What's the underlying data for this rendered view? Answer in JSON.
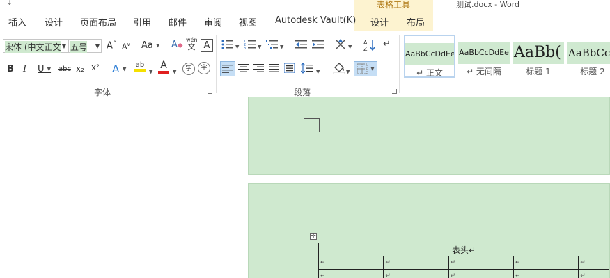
{
  "title_bar": {
    "quick_access_arrow": "⇣",
    "contextual_label": "表格工具",
    "document_title": "测试.docx - Word"
  },
  "tabs": [
    "插入",
    "设计",
    "页面布局",
    "引用",
    "邮件",
    "审阅",
    "视图",
    "Autodesk Vault(K)",
    "设计",
    "布局"
  ],
  "font_group": {
    "font_name": "宋体 (中文正文",
    "font_size": "五号",
    "grow_font": "A",
    "shrink_font": "A",
    "change_case": "Aa",
    "clear_format_icon": "A",
    "phonetic_top": "wén",
    "phonetic_bottom": "文",
    "char_border": "A",
    "bold": "B",
    "italic": "I",
    "underline": "U",
    "strikethrough": "abc",
    "subscript": "x₂",
    "superscript": "x²",
    "text_effect": "A",
    "highlight": "ab",
    "font_color": "A",
    "enclosed_char": "字",
    "label": "字体"
  },
  "paragraph_group": {
    "label": "段落"
  },
  "styles": [
    {
      "sample": "AaBbCcDdEe",
      "name": "↵ 正文"
    },
    {
      "sample": "AaBbCcDdEe",
      "name": "↵ 无间隔"
    },
    {
      "sample": "AaBb(",
      "name": "标题 1"
    },
    {
      "sample": "AaBbCc",
      "name": "标题 2"
    }
  ],
  "document": {
    "table_header": "表头↵",
    "cell_mark": "↵",
    "table_move_handle": "✛"
  },
  "colors": {
    "page_background": "#cfe9cf",
    "highlight_yellow": "#f5e000",
    "font_color_red": "#e02020",
    "contextual_tab": "#fdf3d0"
  }
}
